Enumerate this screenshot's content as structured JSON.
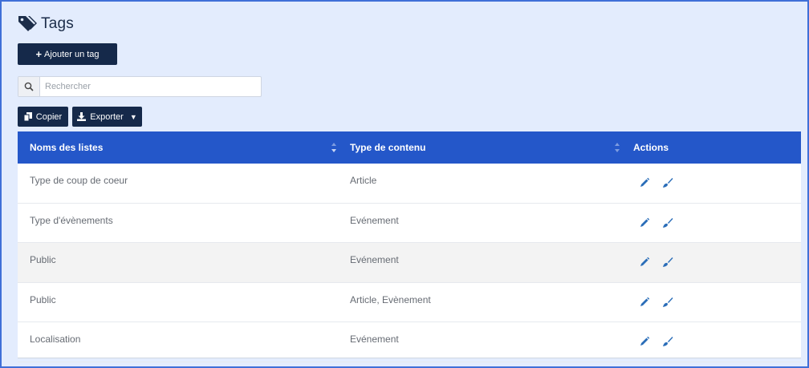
{
  "page": {
    "title": "Tags",
    "title_icon": "tags-icon"
  },
  "toolbar": {
    "add_label": "Ajouter un tag",
    "copy_label": "Copier",
    "export_label": "Exporter"
  },
  "search": {
    "placeholder": "Rechercher",
    "value": ""
  },
  "table": {
    "headers": [
      "Noms des listes",
      "Type de contenu",
      "Actions"
    ],
    "rows": [
      {
        "name": "Type de coup de coeur",
        "type": "Article"
      },
      {
        "name": "Type d'évènements",
        "type": "Evénement"
      },
      {
        "name": "Public",
        "type": "Evénement"
      },
      {
        "name": "Public",
        "type": "Article, Evènement"
      },
      {
        "name": "Localisation",
        "type": "Evénement"
      }
    ]
  },
  "colors": {
    "background": "#e3ecfd",
    "dark_button": "#15294a",
    "header_blue": "#2457c9",
    "action_icon": "#2a6db8"
  }
}
